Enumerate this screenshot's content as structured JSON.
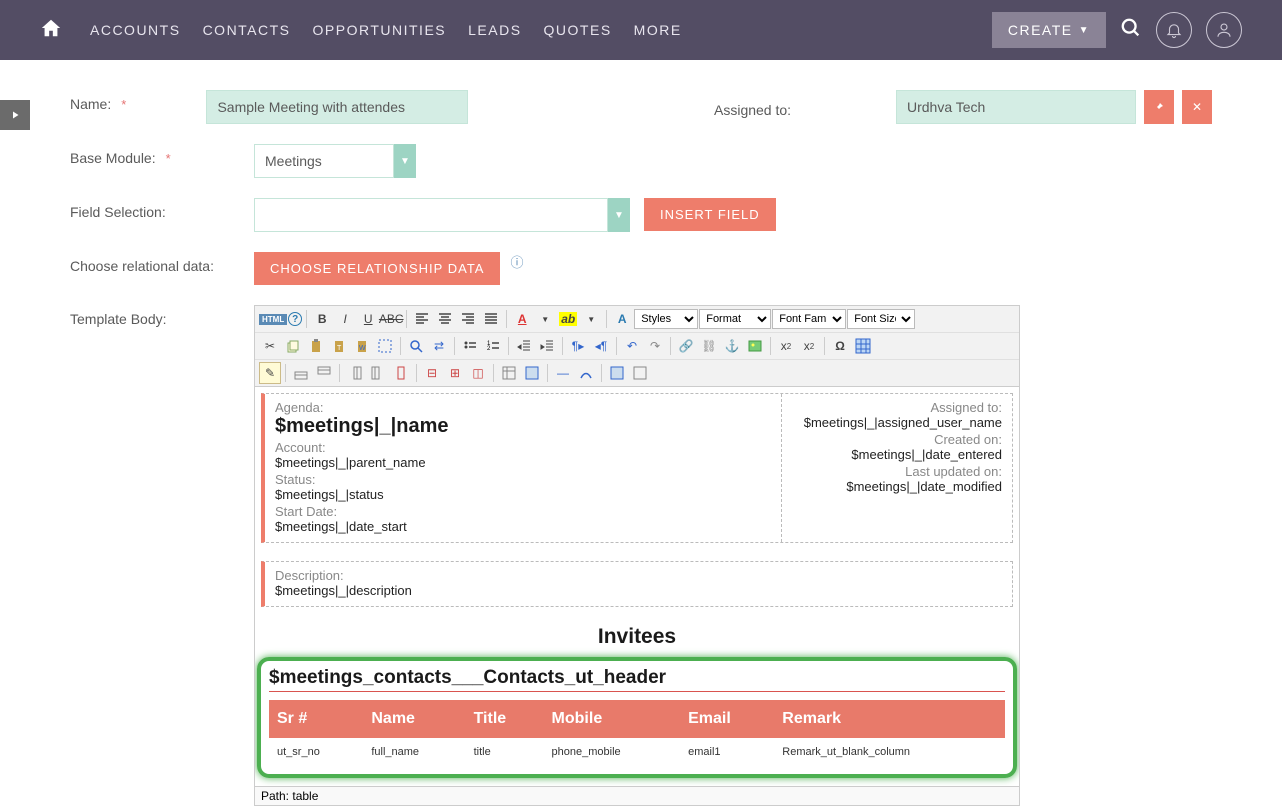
{
  "nav": {
    "items": [
      "ACCOUNTS",
      "CONTACTS",
      "OPPORTUNITIES",
      "LEADS",
      "QUOTES",
      "MORE"
    ],
    "create": "CREATE"
  },
  "form": {
    "name_label": "Name:",
    "name_value": "Sample Meeting with attendes",
    "assigned_label": "Assigned to:",
    "assigned_value": "Urdhva Tech",
    "base_module_label": "Base Module:",
    "base_module_value": "Meetings",
    "field_selection_label": "Field Selection:",
    "field_selection_value": "",
    "insert_field_btn": "INSERT FIELD",
    "relational_label": "Choose relational data:",
    "relational_btn": "CHOOSE RELATIONSHIP DATA",
    "template_body_label": "Template Body:"
  },
  "editor": {
    "html_label": "HTML",
    "styles": "Styles",
    "format": "Format",
    "font_family": "Font Family",
    "font_size": "Font Size",
    "path": "Path: table"
  },
  "content": {
    "agenda_label": "Agenda:",
    "agenda_val": "$meetings|_|name",
    "account_label": "Account:",
    "account_val": "$meetings|_|parent_name",
    "status_label": "Status:",
    "status_val": "$meetings|_|status",
    "start_label": "Start Date:",
    "start_val": "$meetings|_|date_start",
    "assigned_to_label": "Assigned to:",
    "assigned_to_val": "$meetings|_|assigned_user_name",
    "created_label": "Created on:",
    "created_val": "$meetings|_|date_entered",
    "updated_label": "Last updated on:",
    "updated_val": "$meetings|_|date_modified",
    "desc_label": "Description:",
    "desc_val": "$meetings|_|description",
    "invitees_heading": "Invitees",
    "sub_heading": "$meetings_contacts___Contacts_ut_header",
    "table": {
      "headers": [
        "Sr #",
        "Name",
        "Title",
        "Mobile",
        "Email",
        "Remark"
      ],
      "row": [
        "ut_sr_no",
        "full_name",
        "title",
        "phone_mobile",
        "email1",
        "Remark_ut_blank_column"
      ]
    }
  }
}
